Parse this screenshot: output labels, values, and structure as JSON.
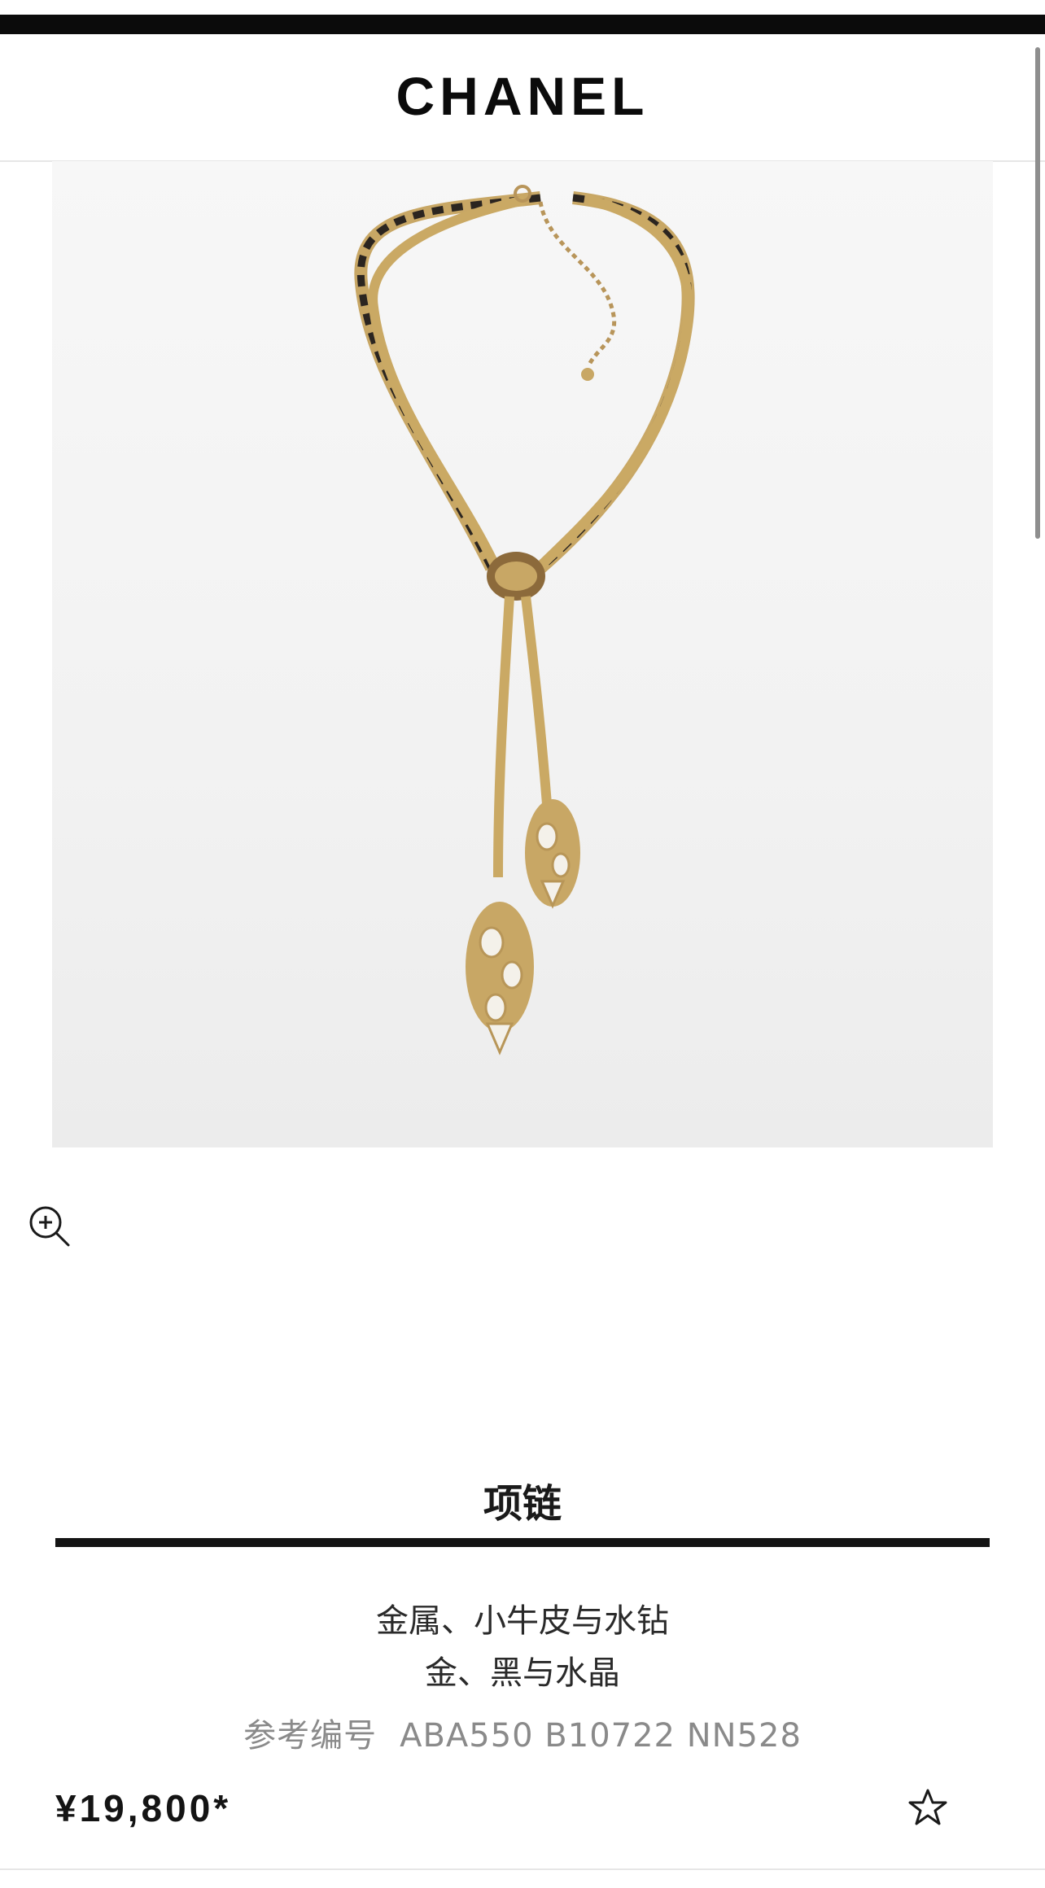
{
  "header": {
    "brand": "CHANEL"
  },
  "product": {
    "image_alt": "necklace product image",
    "title": "项链",
    "material_line1": "金属、小牛皮与水钻",
    "material_line2": "金、黑与水晶",
    "ref_label": "参考编号",
    "ref_code": "ABA550 B10722 NN528",
    "price": "¥19,800*"
  },
  "icons": {
    "zoom": "zoom-in-icon",
    "favorite": "star-outline-icon"
  },
  "colors": {
    "black": "#0b0b0b",
    "gold": "#c8a765",
    "leather": "#2b2520",
    "image_bg": "#f2f2f2"
  }
}
